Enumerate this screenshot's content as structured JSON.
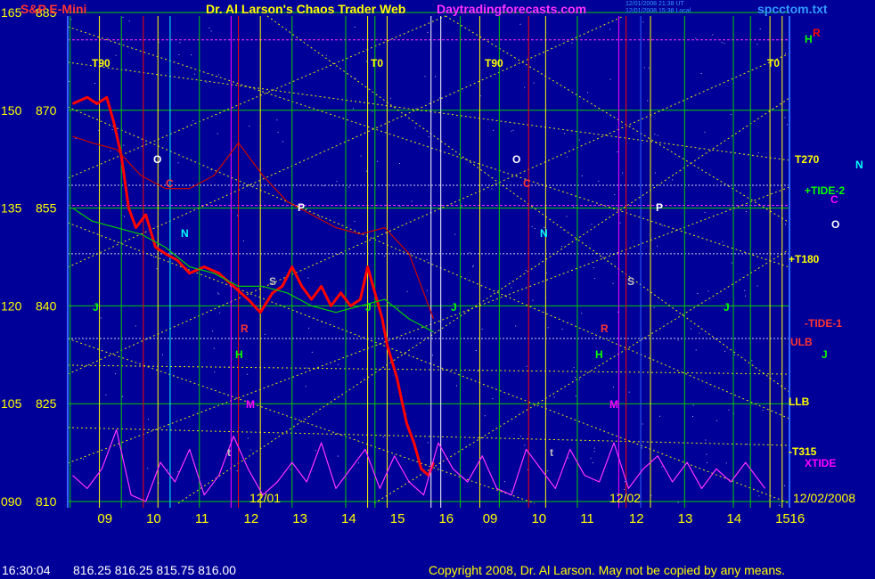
{
  "header": {
    "symbol": "S&P E-Mini",
    "title": "Dr. Al Larson's Chaos Trader Web",
    "site": "Daytradingforecasts.com",
    "stamp1": "12/01/2008 21:38 UT",
    "stamp2": "12/01/2008 15:38 Local",
    "file": "spcctom.txt"
  },
  "status": {
    "time": "16:30:04",
    "quote": "816.25 816.25 815.75 816.00"
  },
  "copyright": "Copyright 2008, Dr. Al Larson. May not be copied by any means.",
  "colors": {
    "background": "#000099",
    "price": "#ff0000",
    "wave": "#ff33ff",
    "grid_green": "#00cc00",
    "grid_yellow": "#ffff00",
    "band_red": "#cc0000"
  },
  "chart_data": {
    "type": "line",
    "title": "S&P E-Mini",
    "y_ticks_left": [
      "165",
      "150",
      "135",
      "120",
      "105",
      "090"
    ],
    "y_ticks_price": [
      "885",
      "870",
      "855",
      "840",
      "825",
      "810"
    ],
    "ylim": [
      810,
      885
    ],
    "x_ticks": [
      "09",
      "10",
      "11",
      "12",
      "13",
      "14",
      "15",
      "16",
      "09",
      "10",
      "11",
      "12",
      "13",
      "14",
      "15",
      "16"
    ],
    "date_labels": [
      "12/01",
      "12/02",
      "12/02/2008"
    ],
    "vertical_markers": [
      "T90",
      "T0",
      "T90",
      "T0"
    ],
    "right_labels": [
      {
        "text": "H",
        "color": "#00ff00"
      },
      {
        "text": "R",
        "color": "#ff0000"
      },
      {
        "text": "T270",
        "color": "#ffff00"
      },
      {
        "text": "N",
        "color": "#00ffff"
      },
      {
        "text": "+TIDE-2",
        "color": "#00ff00"
      },
      {
        "text": "C",
        "color": "#ff00ff"
      },
      {
        "text": "O",
        "color": "#ffffff"
      },
      {
        "text": "+T180",
        "color": "#ffff00"
      },
      {
        "text": "-TIDE-1",
        "color": "#ff3333"
      },
      {
        "text": "ULB",
        "color": "#ff3333"
      },
      {
        "text": "J",
        "color": "#00ff00"
      },
      {
        "text": "LLB",
        "color": "#ffff00"
      },
      {
        "text": "-T315",
        "color": "#ffff00"
      },
      {
        "text": "XTIDE",
        "color": "#ff00ff"
      }
    ],
    "session1_markers": [
      {
        "text": "O",
        "color": "#ffffff"
      },
      {
        "text": "C",
        "color": "#ff3333"
      },
      {
        "text": "N",
        "color": "#00ffff"
      },
      {
        "text": "P",
        "color": "#ffffff"
      },
      {
        "text": "S",
        "color": "#c0c0c0"
      },
      {
        "text": "J",
        "color": "#00ff00"
      },
      {
        "text": "R",
        "color": "#ff3333"
      },
      {
        "text": "H",
        "color": "#00ff00"
      },
      {
        "text": "M",
        "color": "#ff00ff"
      },
      {
        "text": "t",
        "color": "#c0c0c0"
      },
      {
        "text": "J",
        "color": "#00ff00"
      }
    ],
    "session2_markers": [
      {
        "text": "O",
        "color": "#ffffff"
      },
      {
        "text": "C",
        "color": "#ff3333"
      },
      {
        "text": "N",
        "color": "#00ffff"
      },
      {
        "text": "P",
        "color": "#ffffff"
      },
      {
        "text": "S",
        "color": "#c0c0c0"
      },
      {
        "text": "J",
        "color": "#00ff00"
      },
      {
        "text": "R",
        "color": "#ff3333"
      },
      {
        "text": "H",
        "color": "#00ff00"
      },
      {
        "text": "M",
        "color": "#ff00ff"
      },
      {
        "text": "t",
        "color": "#c0c0c0"
      },
      {
        "text": "J",
        "color": "#00ff00"
      }
    ],
    "series": [
      {
        "name": "price",
        "color": "#ff0000",
        "x": [
          8.6,
          8.9,
          9.1,
          9.3,
          9.45,
          9.6,
          9.75,
          9.9,
          10.1,
          10.3,
          10.5,
          10.75,
          11.0,
          11.3,
          11.6,
          11.9,
          12.2,
          12.45,
          12.7,
          12.9,
          13.1,
          13.3,
          13.5,
          13.7,
          13.9,
          14.1,
          14.3,
          14.5,
          14.65,
          14.8,
          14.95,
          15.05,
          15.25,
          15.45,
          15.6,
          15.75,
          15.9,
          16.0
        ],
        "y": [
          871,
          872,
          871,
          872,
          868,
          863,
          855,
          852,
          854,
          849,
          848,
          847,
          845,
          846,
          845,
          843,
          841,
          839,
          842,
          843,
          846,
          843,
          841,
          843,
          840,
          842,
          840,
          841,
          846,
          842,
          838,
          834,
          829,
          822,
          819,
          815,
          814,
          816
        ]
      },
      {
        "name": "green envelope",
        "color": "#00cc00",
        "x": [
          8.6,
          9.0,
          9.5,
          10.0,
          10.5,
          11.0,
          11.5,
          12.0,
          12.5,
          13.0,
          13.5,
          14.0,
          14.5,
          15.0,
          15.5,
          16.0
        ],
        "y": [
          855,
          853,
          852,
          851,
          849,
          846,
          845,
          843,
          843,
          842,
          840,
          839,
          840,
          841,
          838,
          836
        ]
      },
      {
        "name": "red band",
        "color": "#cc0000",
        "x": [
          8.6,
          9.0,
          9.5,
          10.0,
          10.5,
          11.0,
          11.5,
          12.0,
          12.5,
          13.0,
          13.5,
          14.0,
          14.5,
          15.0,
          15.5,
          16.0
        ],
        "y": [
          866,
          865,
          864,
          860,
          858,
          858,
          860,
          865,
          860,
          856,
          854,
          852,
          851,
          852,
          848,
          838
        ]
      },
      {
        "name": "magenta wave",
        "color": "#ff33ff",
        "x": [
          8.6,
          8.9,
          9.2,
          9.5,
          9.8,
          10.1,
          10.4,
          10.7,
          11.0,
          11.3,
          11.6,
          11.9,
          12.2,
          12.5,
          12.8,
          13.1,
          13.4,
          13.7,
          14.0,
          14.3,
          14.6,
          14.9,
          15.2,
          15.5,
          15.8,
          16.1,
          16.4,
          16.7,
          17.0,
          17.3,
          17.6,
          17.9,
          18.2,
          18.5,
          18.8,
          19.1,
          19.4,
          19.7,
          20.0,
          20.3,
          20.6,
          20.9,
          21.2,
          21.5,
          21.8,
          22.1,
          22.4,
          22.8
        ],
        "y": [
          814,
          812,
          815,
          821,
          811,
          810,
          816,
          813,
          818,
          811,
          814,
          820,
          815,
          811,
          813,
          816,
          813,
          819,
          812,
          815,
          818,
          812,
          817,
          813,
          811,
          819,
          815,
          813,
          817,
          812,
          811,
          818,
          815,
          812,
          818,
          814,
          813,
          819,
          812,
          815,
          817,
          813,
          816,
          812,
          815,
          813,
          816,
          812
        ]
      }
    ],
    "grid": true
  }
}
